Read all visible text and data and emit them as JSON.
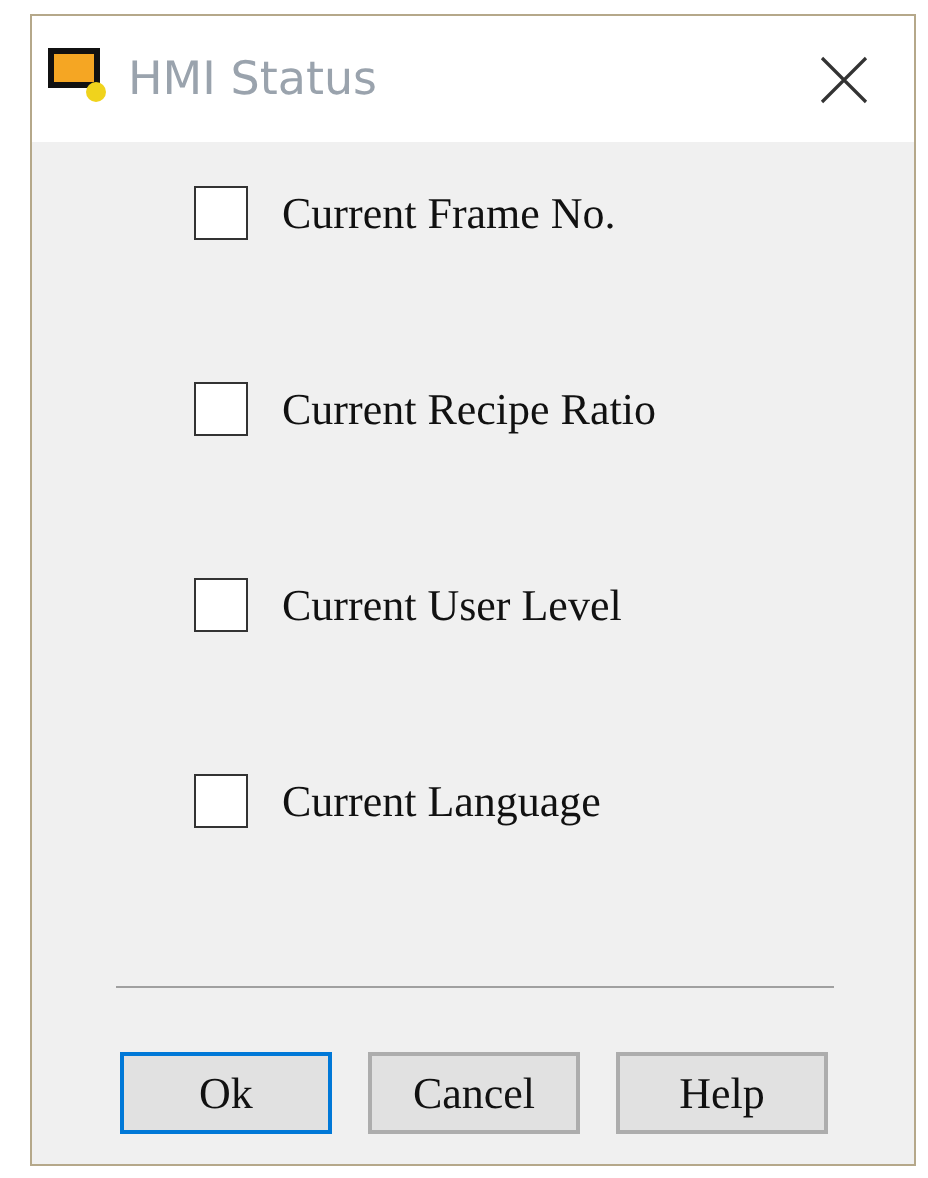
{
  "window": {
    "title": "HMI Status"
  },
  "options": [
    {
      "label": "Current Frame No.",
      "checked": false
    },
    {
      "label": "Current Recipe Ratio",
      "checked": false
    },
    {
      "label": "Current User Level",
      "checked": false
    },
    {
      "label": "Current Language",
      "checked": false
    }
  ],
  "buttons": [
    {
      "label": "Ok",
      "focused": true
    },
    {
      "label": "Cancel",
      "focused": false
    },
    {
      "label": "Help",
      "focused": false
    }
  ]
}
